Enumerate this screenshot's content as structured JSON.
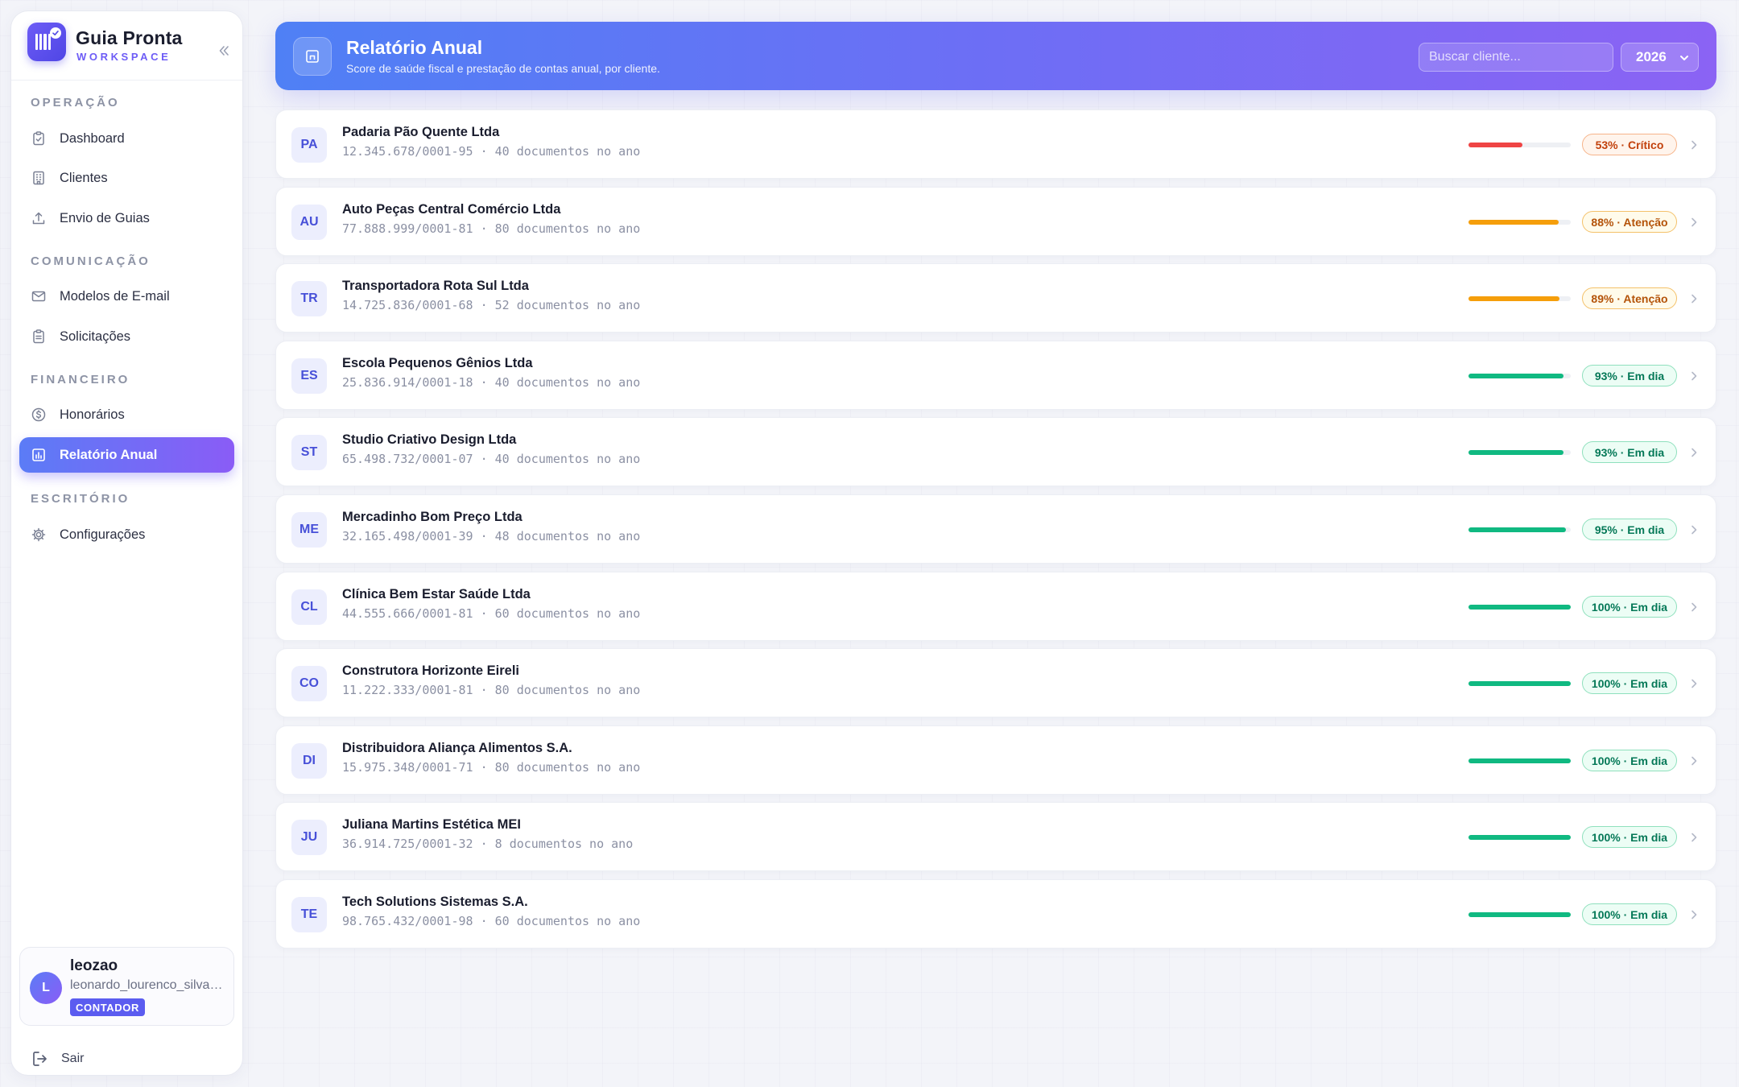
{
  "brand": {
    "title": "Guia Pronta",
    "subtitle": "WORKSPACE"
  },
  "sidebar": {
    "sections": [
      {
        "label": "OPERAÇÃO",
        "items": [
          {
            "label": "Dashboard",
            "icon": "clipboard-check-icon"
          },
          {
            "label": "Clientes",
            "icon": "building-icon"
          },
          {
            "label": "Envio de Guias",
            "icon": "upload-icon"
          }
        ]
      },
      {
        "label": "COMUNICAÇÃO",
        "items": [
          {
            "label": "Modelos de E-mail",
            "icon": "mail-icon"
          },
          {
            "label": "Solicitações",
            "icon": "clipboard-list-icon"
          }
        ]
      },
      {
        "label": "FINANCEIRO",
        "items": [
          {
            "label": "Honorários",
            "icon": "dollar-circle-icon"
          },
          {
            "label": "Relatório Anual",
            "icon": "report-icon",
            "active": true
          }
        ]
      },
      {
        "label": "ESCRITÓRIO",
        "items": [
          {
            "label": "Configurações",
            "icon": "gear-icon"
          }
        ]
      }
    ],
    "user": {
      "initial": "L",
      "name": "leozao",
      "email": "leonardo_lourenco_silva@guiapronta.com",
      "role": "CONTADOR"
    },
    "logout_label": "Sair"
  },
  "header": {
    "title": "Relatório Anual",
    "subtitle": "Score de saúde fiscal e prestação de contas anual, por cliente.",
    "search_placeholder": "Buscar cliente...",
    "year": "2026"
  },
  "colors": {
    "accent": "#6d5cf6",
    "critico": "#ef4444",
    "atencao": "#f59e0b",
    "emdia": "#10b981"
  },
  "clients": [
    {
      "initials": "PA",
      "name": "Padaria Pão Quente Ltda",
      "meta": "12.345.678/0001-95 · 40 documentos no ano",
      "score": 53,
      "status": "critico",
      "badge": "53% · Crítico"
    },
    {
      "initials": "AU",
      "name": "Auto Peças Central Comércio Ltda",
      "meta": "77.888.999/0001-81 · 80 documentos no ano",
      "score": 88,
      "status": "atencao",
      "badge": "88% · Atenção"
    },
    {
      "initials": "TR",
      "name": "Transportadora Rota Sul Ltda",
      "meta": "14.725.836/0001-68 · 52 documentos no ano",
      "score": 89,
      "status": "atencao",
      "badge": "89% · Atenção"
    },
    {
      "initials": "ES",
      "name": "Escola Pequenos Gênios Ltda",
      "meta": "25.836.914/0001-18 · 40 documentos no ano",
      "score": 93,
      "status": "emdia",
      "badge": "93% · Em dia"
    },
    {
      "initials": "ST",
      "name": "Studio Criativo Design Ltda",
      "meta": "65.498.732/0001-07 · 40 documentos no ano",
      "score": 93,
      "status": "emdia",
      "badge": "93% · Em dia"
    },
    {
      "initials": "ME",
      "name": "Mercadinho Bom Preço Ltda",
      "meta": "32.165.498/0001-39 · 48 documentos no ano",
      "score": 95,
      "status": "emdia",
      "badge": "95% · Em dia"
    },
    {
      "initials": "CL",
      "name": "Clínica Bem Estar Saúde Ltda",
      "meta": "44.555.666/0001-81 · 60 documentos no ano",
      "score": 100,
      "status": "emdia",
      "badge": "100% · Em dia"
    },
    {
      "initials": "CO",
      "name": "Construtora Horizonte Eireli",
      "meta": "11.222.333/0001-81 · 80 documentos no ano",
      "score": 100,
      "status": "emdia",
      "badge": "100% · Em dia"
    },
    {
      "initials": "DI",
      "name": "Distribuidora Aliança Alimentos S.A.",
      "meta": "15.975.348/0001-71 · 80 documentos no ano",
      "score": 100,
      "status": "emdia",
      "badge": "100% · Em dia"
    },
    {
      "initials": "JU",
      "name": "Juliana Martins Estética MEI",
      "meta": "36.914.725/0001-32 · 8 documentos no ano",
      "score": 100,
      "status": "emdia",
      "badge": "100% · Em dia"
    },
    {
      "initials": "TE",
      "name": "Tech Solutions Sistemas S.A.",
      "meta": "98.765.432/0001-98 · 60 documentos no ano",
      "score": 100,
      "status": "emdia",
      "badge": "100% · Em dia"
    }
  ]
}
